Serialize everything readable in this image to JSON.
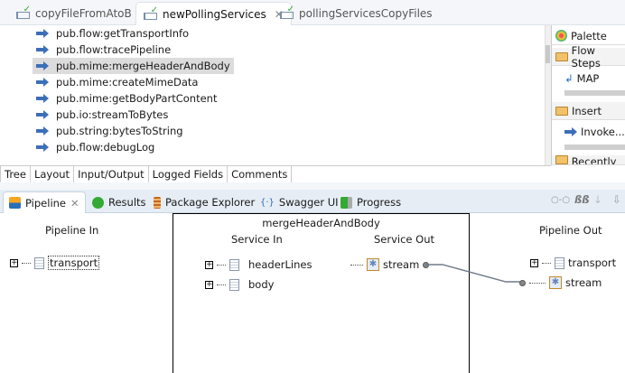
{
  "editor_tabs": [
    {
      "label": "copyFileFromAtoB"
    },
    {
      "label": "newPollingServices",
      "active": true
    },
    {
      "label": "pollingServicesCopyFiles"
    }
  ],
  "flow_items": [
    "pub.flow:getTransportInfo",
    "pub.flow:tracePipeline",
    "pub.mime:mergeHeaderAndBody",
    "pub.mime:createMimeData",
    "pub.mime:getBodyPartContent",
    "pub.io:streamToBytes",
    "pub.string:bytesToString",
    "pub.flow:debugLog"
  ],
  "selected_item": 2,
  "palette": {
    "title": "Palette",
    "sections": [
      {
        "label": "Flow Steps",
        "item": "MAP"
      },
      {
        "label": "Insert",
        "item": "Invoke..."
      },
      {
        "label": "Recently U"
      }
    ]
  },
  "bottom_tabs": [
    "Tree",
    "Layout",
    "Input/Output",
    "Logged Fields",
    "Comments"
  ],
  "view_tabs": [
    "Pipeline",
    "Results",
    "Package Explorer",
    "Swagger UI",
    "Progress"
  ],
  "pipeline": {
    "in_title": "Pipeline In",
    "out_title": "Pipeline Out",
    "service_name": "mergeHeaderAndBody",
    "service_in": "Service In",
    "service_out": "Service Out",
    "in_vars": [
      "transport"
    ],
    "service_in_vars": [
      "headerLines",
      "body"
    ],
    "service_out_vars": [
      "stream"
    ],
    "out_vars": [
      "transport",
      "stream"
    ]
  }
}
